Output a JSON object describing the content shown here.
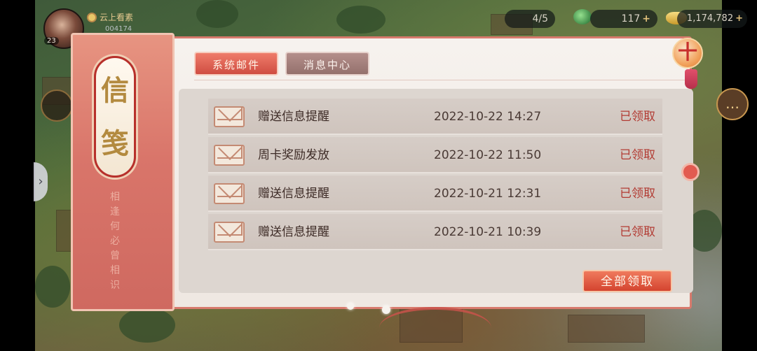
{
  "hud": {
    "player_name": "云上看素",
    "player_id": "004174",
    "level": "23",
    "counter": "4/5",
    "coins": "117",
    "coins_plus": "+",
    "ingots": "1,174,782",
    "ingots_plus": "+"
  },
  "dialog": {
    "title_chars": [
      "信",
      "笺"
    ],
    "poem": "相逢何必曾相识",
    "tabs": [
      {
        "label": "系统邮件",
        "active": true
      },
      {
        "label": "消息中心",
        "active": false
      }
    ],
    "mails": [
      {
        "title": "赠送信息提醒",
        "date": "2022-10-22 14:27",
        "status": "已领取"
      },
      {
        "title": "周卡奖励发放",
        "date": "2022-10-22 11:50",
        "status": "已领取"
      },
      {
        "title": "赠送信息提醒",
        "date": "2022-10-21 12:31",
        "status": "已领取"
      },
      {
        "title": "赠送信息提醒",
        "date": "2022-10-21 10:39",
        "status": "已领取"
      }
    ],
    "claim_all_label": "全部领取",
    "close_label": "十"
  },
  "icons": {
    "close": "close-icon",
    "envelope": "envelope-icon",
    "chat": "chat-icon",
    "coin": "coin-icon",
    "ingot": "ingot-icon"
  },
  "colors": {
    "accent": "#cf4d42",
    "status": "#b23b33",
    "panel": "#f6f2ee"
  }
}
